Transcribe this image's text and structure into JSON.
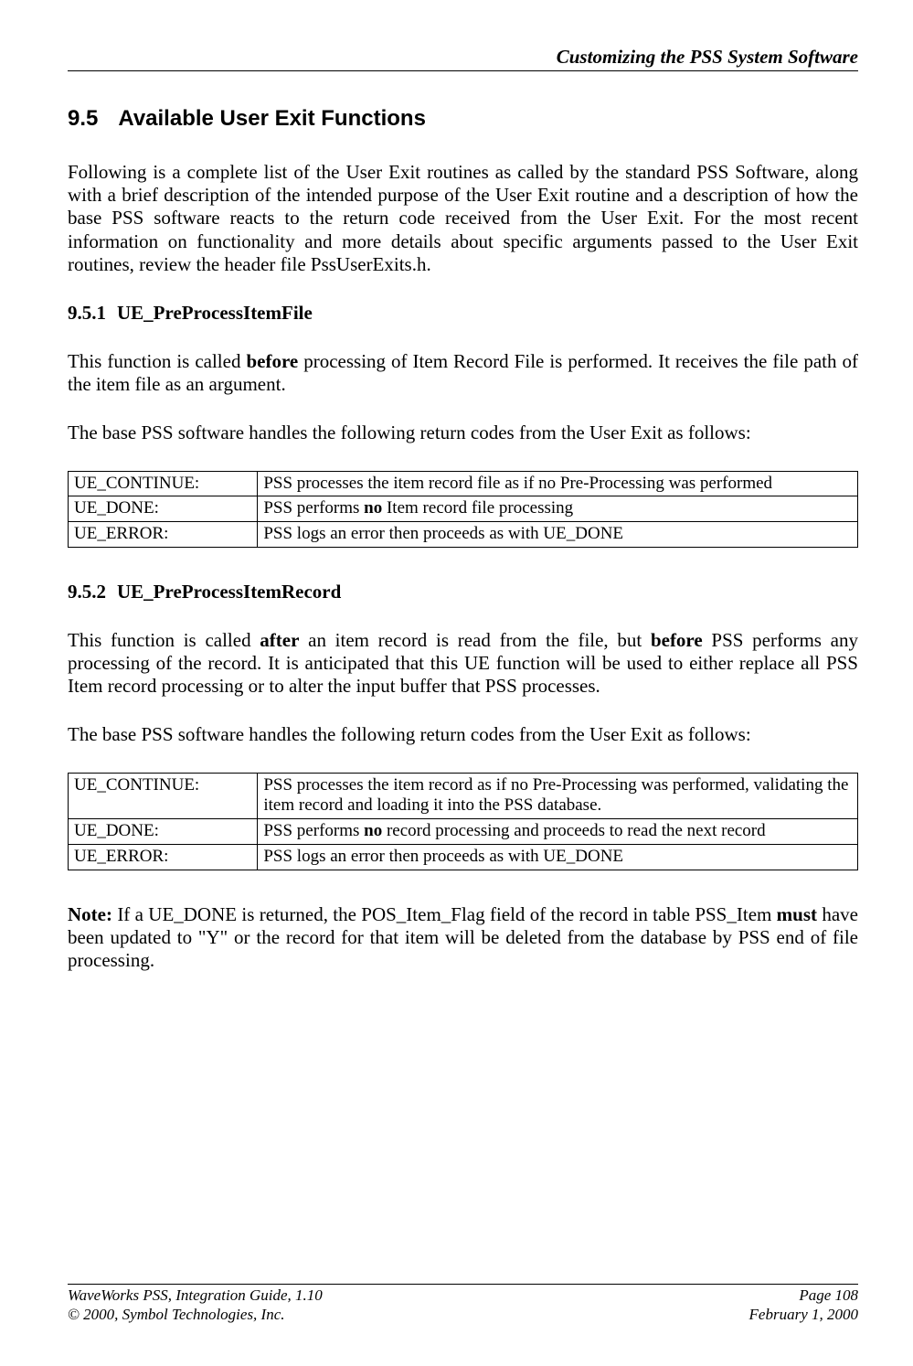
{
  "header": {
    "title": "Customizing the PSS System Software"
  },
  "section": {
    "number": "9.5",
    "title": "Available User Exit Functions",
    "intro": "Following is a complete list of the User Exit routines as called by the standard PSS Software, along with a brief description of the intended purpose of the User Exit routine and a description of how the base PSS software reacts to the return code received from the User Exit.  For the most recent information on functionality and more details about specific arguments passed to the User Exit routines, review the header file PssUserExits.h."
  },
  "sub1": {
    "number": "9.5.1",
    "title": "UE_PreProcessItemFile",
    "para1a": "This function is called ",
    "para1b": "before",
    "para1c": " processing of Item Record File is performed.  It receives the file path of the item file as an argument.",
    "para2": "The base PSS software handles the following return codes from the User Exit as follows:",
    "table": [
      {
        "code": "UE_CONTINUE:",
        "desc_pre": "PSS processes the item record file as if no Pre-Processing was performed",
        "desc_bold": "",
        "desc_post": ""
      },
      {
        "code": "UE_DONE:",
        "desc_pre": "PSS performs ",
        "desc_bold": "no",
        "desc_post": " Item record file processing"
      },
      {
        "code": "UE_ERROR:",
        "desc_pre": "PSS logs an error then proceeds as with UE_DONE",
        "desc_bold": "",
        "desc_post": ""
      }
    ]
  },
  "sub2": {
    "number": "9.5.2",
    "title": "UE_PreProcessItemRecord",
    "para1a": "This function is called ",
    "para1b": "after",
    "para1c": " an item record is read from the file, but ",
    "para1d": "before",
    "para1e": " PSS performs any processing of the record.  It is anticipated that this UE function will be used to either replace all PSS Item record processing or to alter the input buffer that PSS processes.",
    "para2": "The base PSS software handles the following return codes from the User Exit as follows:",
    "table": [
      {
        "code": "UE_CONTINUE:",
        "desc_pre": "PSS processes the item record as if no Pre-Processing was performed, validating the item record and loading it into the PSS database.",
        "desc_bold": "",
        "desc_post": ""
      },
      {
        "code": "UE_DONE:",
        "desc_pre": "PSS performs ",
        "desc_bold": "no",
        "desc_post": " record processing and proceeds to read the next record"
      },
      {
        "code": "UE_ERROR:",
        "desc_pre": "PSS logs an error then proceeds as with UE_DONE",
        "desc_bold": "",
        "desc_post": ""
      }
    ],
    "note_label": "Note:",
    "note_a": "  If a UE_DONE is returned, the POS_Item_Flag field of the record in table PSS_Item ",
    "note_b": "must",
    "note_c": " have been updated to \"Y\" or the record for that item will be deleted from the database by PSS end of file processing."
  },
  "footer": {
    "left1": "WaveWorks PSS, Integration Guide, 1.10",
    "right1": "Page 108",
    "left2": "© 2000, Symbol Technologies, Inc.",
    "right2": "February 1, 2000"
  }
}
